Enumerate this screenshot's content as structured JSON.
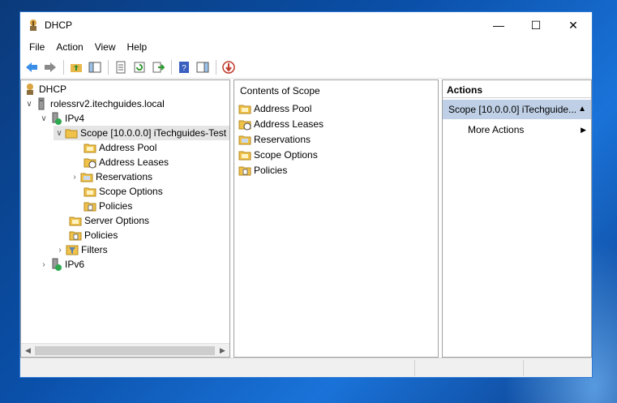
{
  "window": {
    "title": "DHCP",
    "minimize": "—",
    "maximize": "☐",
    "close": "✕"
  },
  "menu": {
    "items": [
      "File",
      "Action",
      "View",
      "Help"
    ]
  },
  "tree": {
    "items": [
      {
        "label": "DHCP",
        "icon": "dhcp-icon"
      },
      {
        "label": "rolessrv2.itechguides.local",
        "icon": "server-icon"
      },
      {
        "label": "IPv4",
        "icon": "ipv4-icon"
      },
      {
        "label": "Scope [10.0.0.0] iTechguides-Test",
        "icon": "scope-folder-icon"
      },
      {
        "label": "Address Pool",
        "icon": "folder-icon"
      },
      {
        "label": "Address Leases",
        "icon": "folder-clock-icon"
      },
      {
        "label": "Reservations",
        "icon": "reservations-icon"
      },
      {
        "label": "Scope Options",
        "icon": "folder-icon"
      },
      {
        "label": "Policies",
        "icon": "policies-icon"
      },
      {
        "label": "Server Options",
        "icon": "folder-icon"
      },
      {
        "label": "Policies",
        "icon": "policies-icon"
      },
      {
        "label": "Filters",
        "icon": "filter-icon"
      },
      {
        "label": "IPv6",
        "icon": "ipv6-icon"
      }
    ]
  },
  "content": {
    "header": "Contents of Scope",
    "items": [
      "Address Pool",
      "Address Leases",
      "Reservations",
      "Scope Options",
      "Policies"
    ]
  },
  "actions": {
    "header": "Actions",
    "scope_label": "Scope [10.0.0.0] iTechguide...",
    "more_actions": "More Actions"
  },
  "colors": {
    "accent": "#2b78d4",
    "selection": "#bfd0e6",
    "folder": "#f0c24a"
  }
}
